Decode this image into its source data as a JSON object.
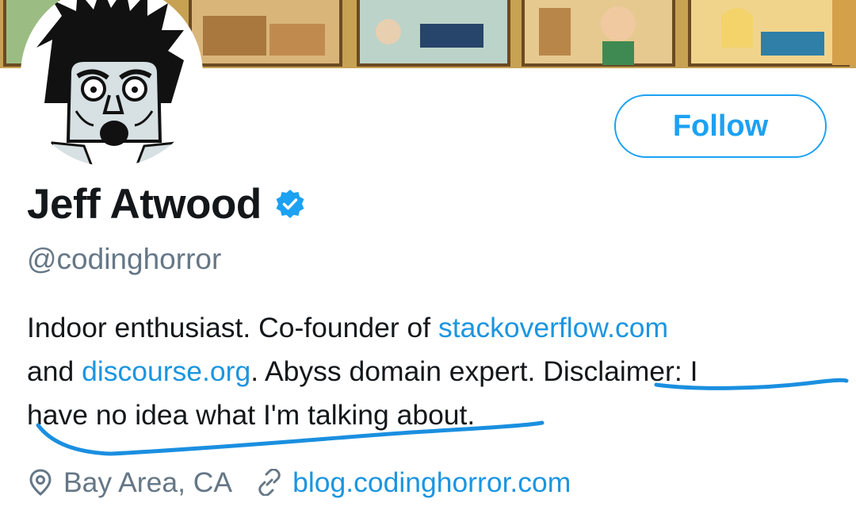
{
  "profile": {
    "display_name": "Jeff Atwood",
    "handle": "@codinghorror",
    "verified": true,
    "follow_label": "Follow",
    "bio": {
      "part1": "Indoor enthusiast. Co-founder of ",
      "link1": "stackoverflow.com",
      "part2": "and ",
      "link2": "discourse.org",
      "part3": ". Abyss domain expert. Disclaimer: I",
      "part4": "have no idea what I'm talking about."
    },
    "location": "Bay Area, CA",
    "website": "blog.codinghorror.com"
  },
  "icons": {
    "verified": "verified-badge-icon",
    "location": "location-pin-icon",
    "link": "link-icon"
  },
  "colors": {
    "accent": "#1da1f2",
    "link": "#1b95e0",
    "secondary_text": "#657786",
    "primary_text": "#14171a",
    "annotation": "#1a8fe0"
  }
}
